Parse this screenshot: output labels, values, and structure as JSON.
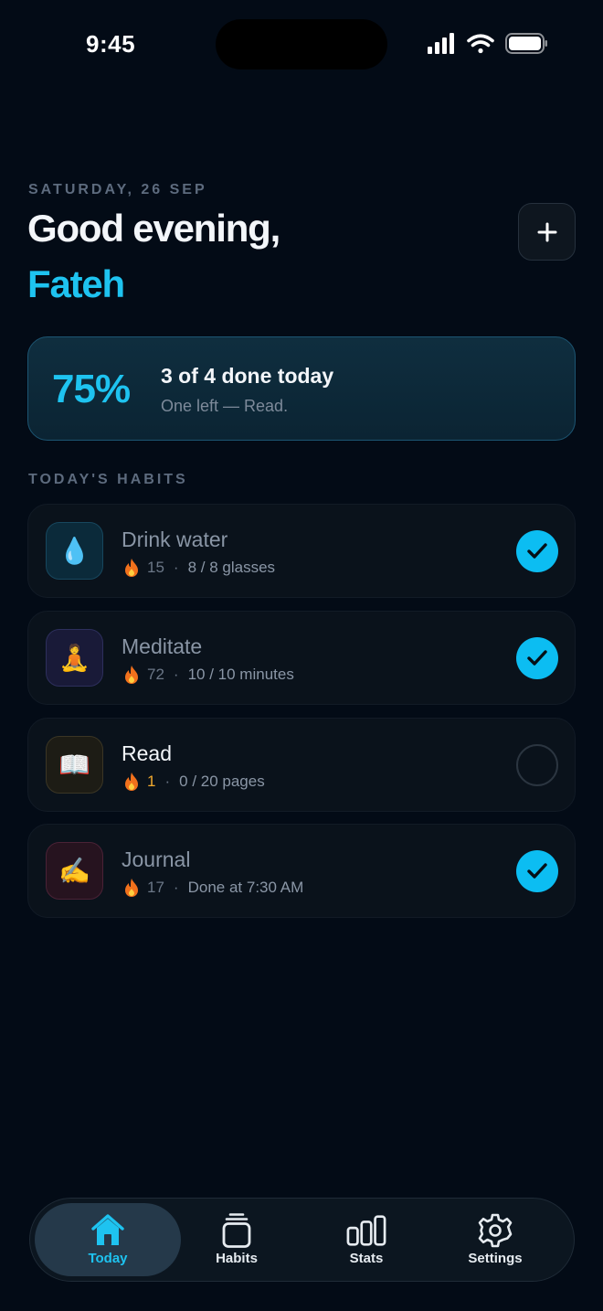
{
  "status_bar": {
    "time": "9:45"
  },
  "header": {
    "date": "SATURDAY, 26 SEP",
    "greeting": "Good evening,",
    "user_name": "Fateh",
    "add_label": "+"
  },
  "progress": {
    "percent_label": "75%",
    "percent_value": 75,
    "done": 3,
    "total": 4,
    "title": "3 of 4 done today",
    "subtitle": "One left — Read."
  },
  "section_title": "TODAY'S HABITS",
  "habits": [
    {
      "name": "Drink water",
      "emoji": "💧",
      "icon": "water-drop-icon",
      "streak": "15",
      "detail": "8 / 8 glasses",
      "done": true,
      "icon_bg": "#0b2a3a",
      "icon_border": "#17475e"
    },
    {
      "name": "Meditate",
      "emoji": "🧘",
      "icon": "meditation-icon",
      "streak": "72",
      "detail": "10 / 10 minutes",
      "done": true,
      "icon_bg": "#191a38",
      "icon_border": "#2d2f5c"
    },
    {
      "name": "Read",
      "emoji": "📖",
      "icon": "book-icon",
      "streak": "1",
      "detail": "0 / 20 pages",
      "done": false,
      "icon_bg": "#1d1c15",
      "icon_border": "#3b3625"
    },
    {
      "name": "Journal",
      "emoji": "✍️",
      "icon": "writing-hand-icon",
      "streak": "17",
      "detail": "Done at 7:30 AM",
      "done": true,
      "icon_bg": "#26131f",
      "icon_border": "#4a2236"
    }
  ],
  "tabs": [
    {
      "label": "Today",
      "icon": "home-icon",
      "active": true
    },
    {
      "label": "Habits",
      "icon": "habits-stack-icon",
      "active": false
    },
    {
      "label": "Stats",
      "icon": "bar-chart-icon",
      "active": false
    },
    {
      "label": "Settings",
      "icon": "gear-icon",
      "active": false
    }
  ],
  "colors": {
    "accent": "#1ec3f0",
    "check": "#0cbdf2",
    "streak_hot": "#f0a92e",
    "background": "#030b16"
  }
}
